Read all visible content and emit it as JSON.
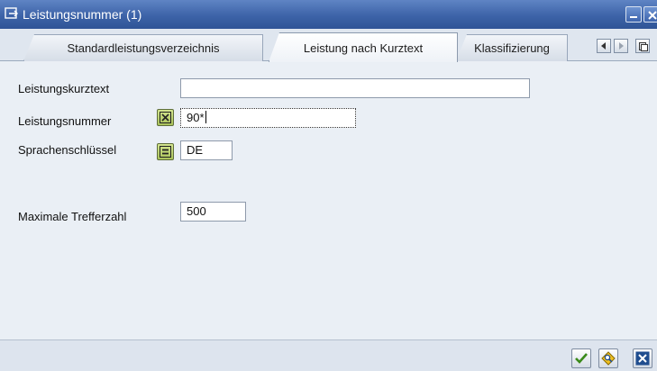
{
  "window": {
    "title": "Leistungsnummer (1)"
  },
  "tabs": [
    {
      "label": "Standardleistungsverzeichnis",
      "active": false
    },
    {
      "label": "Leistung nach Kurztext",
      "active": true
    },
    {
      "label": "Klassifizierung",
      "active": false
    }
  ],
  "form": {
    "kurztext": {
      "label": "Leistungskurztext",
      "value": ""
    },
    "nummer": {
      "label": "Leistungsnummer",
      "value": "90*"
    },
    "sprache": {
      "label": "Sprachenschlüssel",
      "value": "DE"
    },
    "max": {
      "label": "Maximale Trefferzahl",
      "value": "500"
    }
  },
  "icons": {
    "title": "window-icon",
    "minimize": "minimize-icon",
    "close": "close-icon",
    "tab_prev": "arrow-left-icon",
    "tab_next": "arrow-right-icon",
    "tab_list": "tab-list-icon",
    "nummer_option": "selection-option-pattern-icon",
    "sprache_option": "selection-option-equal-icon",
    "ok": "checkmark-icon",
    "search": "search-options-icon",
    "cancel": "cancel-icon"
  },
  "colors": {
    "titlebar": "#3d63a8",
    "background": "#eaeff5",
    "option_button": "#a9c25a",
    "ok_green": "#3a8a1a",
    "cancel_blue": "#1f4d8f"
  }
}
